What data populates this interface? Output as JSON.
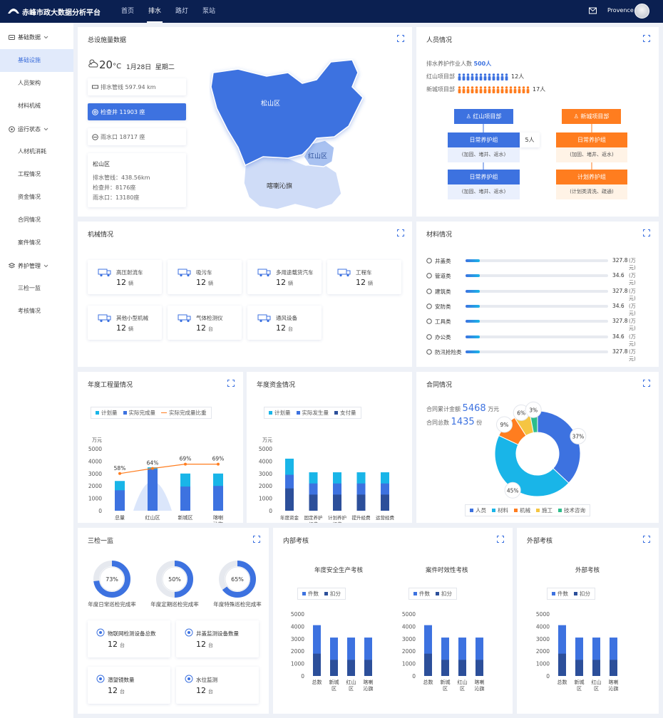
{
  "header": {
    "title": "赤峰市政大数据分析平台",
    "nav": [
      "首页",
      "排水",
      "路灯",
      "泵站"
    ],
    "user": "Provence"
  },
  "sidebar": {
    "groups": [
      {
        "label": "基础数据",
        "items": [
          "基础设施",
          "人员架构",
          "材料机械"
        ]
      },
      {
        "label": "运行状态",
        "items": [
          "人材机消耗",
          "工程情况",
          "资金情况",
          "合同情况",
          "案件情况"
        ]
      },
      {
        "label": "养护管理",
        "items": [
          "三检一监",
          "考核情况"
        ]
      }
    ]
  },
  "facility": {
    "title": "总设施量数据",
    "temp": "20",
    "unit": "°C",
    "date": "1月28日",
    "weekday": "星期二",
    "items": [
      {
        "label": "排水管线 597.94 km"
      },
      {
        "label": "检查井 11903 座"
      },
      {
        "label": "雨水口 18717 座"
      }
    ],
    "detail": {
      "name": "松山区",
      "lines": [
        "排水管线：438.56km",
        "检查井：8176座",
        "雨水口：13180座"
      ]
    },
    "regions": [
      "松山区",
      "红山区",
      "喀喇沁旗"
    ]
  },
  "personnel": {
    "title": "人员情况",
    "total_label": "排水养护作业人数",
    "total": "500人",
    "rows": [
      {
        "label": "红山项目部",
        "count": "12人"
      },
      {
        "label": "新城项目部",
        "count": "17人"
      }
    ],
    "left": {
      "head": "红山项目部",
      "g1": "日常养护组",
      "g1d": "(加固、堵井、返水)",
      "badge": "5人",
      "g2": "日常养护组",
      "g2d": "(加固、堵井、返水)"
    },
    "right": {
      "head": "新城项目部",
      "g1": "日常养护组",
      "g1d": "(加固、堵井、返水)",
      "g2": "计划养护组",
      "g2d": "(计划类清洗、疏通)"
    }
  },
  "machines": {
    "title": "机械情况",
    "items": [
      {
        "name": "高压射流车",
        "value": "12",
        "unit": "辆",
        "icon": "truck-icon"
      },
      {
        "name": "吸污车",
        "value": "12",
        "unit": "辆",
        "icon": "suction-truck-icon"
      },
      {
        "name": "多用途载货汽车",
        "value": "12",
        "unit": "辆",
        "icon": "cargo-truck-icon"
      },
      {
        "name": "工程车",
        "value": "12",
        "unit": "辆",
        "icon": "engineering-truck-icon"
      },
      {
        "name": "其他小型机械",
        "value": "12",
        "unit": "辆",
        "icon": "gear-icon"
      },
      {
        "name": "气体检测仪",
        "value": "12",
        "unit": "台",
        "icon": "detector-icon"
      },
      {
        "name": "通风设备",
        "value": "12",
        "unit": "台",
        "icon": "fan-icon"
      }
    ]
  },
  "materials": {
    "title": "材料情况",
    "unit": "(万元)",
    "items": [
      {
        "name": "井盖类",
        "value": "327.8",
        "pct": 0.1
      },
      {
        "name": "管道类",
        "value": "34.6",
        "pct": 0.1
      },
      {
        "name": "建筑类",
        "value": "327.8",
        "pct": 0.1
      },
      {
        "name": "安防类",
        "value": "34.6",
        "pct": 0.1
      },
      {
        "name": "工具类",
        "value": "327.8",
        "pct": 0.1
      },
      {
        "name": "办公类",
        "value": "34.6",
        "pct": 0.1
      },
      {
        "name": "防汛抢险类",
        "value": "327.8",
        "pct": 0.1
      }
    ]
  },
  "annual_work": {
    "title": "年度工程量情况",
    "legend": [
      "计划量",
      "实际完成量",
      "实际完成量比重"
    ]
  },
  "annual_fund": {
    "title": "年度资金情况",
    "legend": [
      "计划量",
      "实际发生量",
      "支付量"
    ]
  },
  "contract": {
    "title": "合同情况",
    "amount_label": "合同累计金额",
    "amount": "5468",
    "amount_unit": "万元",
    "count_label": "合同总数",
    "count": "1435",
    "count_unit": "份",
    "legend": [
      "人员",
      "材料",
      "机械",
      "施工",
      "技术咨询"
    ]
  },
  "inspection": {
    "title": "三检一监",
    "rings": [
      {
        "label": "年度日常巡检完成率",
        "value": 73,
        "text": "73%"
      },
      {
        "label": "年度定期巡检完成率",
        "value": 50,
        "text": "50%"
      },
      {
        "label": "年度特殊巡检完成率",
        "value": 65,
        "text": "65%"
      }
    ],
    "devices": [
      {
        "name": "物联网检测设备总数",
        "value": "12",
        "unit": "台"
      },
      {
        "name": "井盖监测设备数量",
        "value": "12",
        "unit": "台"
      },
      {
        "name": "潜望镜数量",
        "value": "12",
        "unit": "台"
      },
      {
        "name": "水位监测",
        "value": "12",
        "unit": "台"
      }
    ]
  },
  "internal": {
    "title": "内部考核",
    "sub1": "年度安全生产考核",
    "sub2": "案件时效性考核",
    "legend": [
      "件数",
      "扣分"
    ]
  },
  "external": {
    "title": "外部考核",
    "sub": "外部考核",
    "legend": [
      "件数",
      "扣分"
    ]
  },
  "chart_data": [
    {
      "type": "bar",
      "title": "年度工程量情况",
      "ylabel": "万元",
      "categories": [
        "总量",
        "红山区",
        "新城区",
        "喀喇沁旗"
      ],
      "ylim": [
        0,
        5000
      ],
      "series": [
        {
          "name": "计划量",
          "values": [
            2400,
            3500,
            3000,
            3000
          ]
        },
        {
          "name": "实际完成量",
          "values": [
            1650,
            3350,
            1950,
            2000
          ]
        },
        {
          "name": "实际完成量比重",
          "values": [
            58,
            64,
            69,
            69
          ],
          "labels": [
            "58%",
            "64%",
            "69%",
            "69%"
          ]
        }
      ],
      "yticks": [
        "5000",
        "4000",
        "3000",
        "2000",
        "1000",
        "0"
      ]
    },
    {
      "type": "bar",
      "title": "年度资金情况",
      "ylabel": "万元",
      "categories": [
        "年度资金",
        "固定养护经费",
        "计划养护经费",
        "提升经费",
        "运营经费"
      ],
      "ylim": [
        0,
        5000
      ],
      "series": [
        {
          "name": "计划量",
          "values": [
            4200,
            3100,
            3100,
            3100,
            3100
          ]
        },
        {
          "name": "实际发生量",
          "values": [
            2900,
            2200,
            2200,
            2200,
            2200
          ]
        },
        {
          "name": "支付量",
          "values": [
            1800,
            1300,
            1300,
            1300,
            1300
          ]
        }
      ],
      "yticks": [
        "5000",
        "4000",
        "3000",
        "2000",
        "1000",
        "0"
      ]
    },
    {
      "type": "pie",
      "title": "合同情况",
      "categories": [
        "人员",
        "材料",
        "机械",
        "施工",
        "技术咨询"
      ],
      "values": [
        37,
        45,
        9,
        6,
        3
      ],
      "labels": [
        "37%",
        "45%",
        "9%",
        "6%",
        "3%"
      ]
    },
    {
      "type": "bar",
      "title": "年度安全生产考核",
      "categories": [
        "总数",
        "新城区",
        "红山区",
        "喀喇沁旗"
      ],
      "ylim": [
        0,
        5000
      ],
      "series": [
        {
          "name": "件数",
          "values": [
            4100,
            3100,
            3100,
            3100
          ]
        },
        {
          "name": "扣分",
          "values": [
            1800,
            1300,
            1300,
            1300
          ]
        }
      ],
      "yticks": [
        "5000",
        "4000",
        "3000",
        "2000",
        "1000",
        "0"
      ]
    },
    {
      "type": "bar",
      "title": "案件时效性考核",
      "categories": [
        "总数",
        "新城区",
        "红山区",
        "喀喇沁旗"
      ],
      "ylim": [
        0,
        5000
      ],
      "series": [
        {
          "name": "件数",
          "values": [
            4100,
            3100,
            3100,
            3100
          ]
        },
        {
          "name": "扣分",
          "values": [
            1800,
            1300,
            1300,
            1300
          ]
        }
      ],
      "yticks": [
        "5000",
        "4000",
        "3000",
        "2000",
        "1000",
        "0"
      ]
    },
    {
      "type": "bar",
      "title": "外部考核",
      "categories": [
        "总数",
        "新城区",
        "红山区",
        "喀喇沁旗"
      ],
      "ylim": [
        0,
        5000
      ],
      "series": [
        {
          "name": "件数",
          "values": [
            4100,
            3100,
            3100,
            3100
          ]
        },
        {
          "name": "扣分",
          "values": [
            1800,
            1300,
            1300,
            1300
          ]
        }
      ],
      "yticks": [
        "5000",
        "4000",
        "3000",
        "2000",
        "1000",
        "0"
      ]
    }
  ],
  "colors": {
    "blue": "#3d72e0",
    "cyan": "#19b5e8",
    "dark": "#2c4f9a",
    "orange": "#ff7d1f",
    "green": "#2dbd8c",
    "yellow": "#f5c542"
  }
}
